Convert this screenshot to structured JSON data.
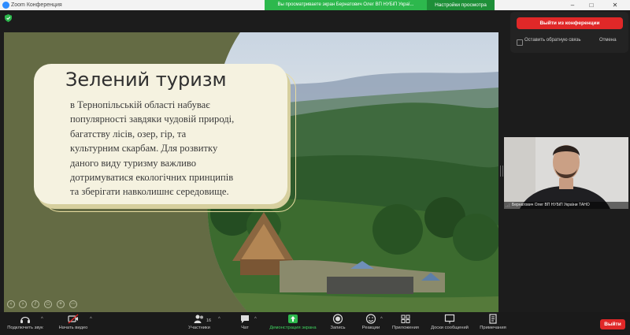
{
  "window": {
    "app_title": "Zoom Конференция",
    "share_banner": "Вы просматриваете экран Бернатович Олег ВП НУБіП Украї...",
    "view_options_label": "Настройки просмотра",
    "controls": {
      "minimize": "–",
      "maximize": "□",
      "close": "✕"
    }
  },
  "slide": {
    "title": "Зелений туризм",
    "body": "в Тернопільській області набуває\nпопулярності завдяки чудовій природі,\nбагатству лісів, озер, гір, та\nкультурним скарбам. Для розвитку\nданого виду туризму   важливо\nдотримуватися екологічних принципів\nта зберігати навколишнє середовище.",
    "background_color": "#646b44",
    "controls": [
      "prev-icon",
      "next-icon",
      "pen-icon",
      "copy-icon",
      "zoom-icon",
      "more-icon"
    ]
  },
  "leave_panel": {
    "leave_button": "Выйти из конференции",
    "feedback_label": "Оставить обратную связь",
    "cancel_label": "Отмена"
  },
  "video": {
    "participant_name": "Бернатович Олег ВП НУБіП України ТАНО"
  },
  "toolbar": {
    "audio": "Подключить звук",
    "video": "Начать видео",
    "participants": "Участники",
    "participants_count": "16",
    "chat": "Чат",
    "share": "Демонстрация экрана",
    "record": "Запись",
    "reactions": "Реакции",
    "apps": "Приложения",
    "whiteboards": "Доски сообщений",
    "notes": "Примечания",
    "end": "Выйти"
  },
  "colors": {
    "accent_green": "#2db84d",
    "end_red": "#e02828",
    "share_green": "#3fd45f"
  }
}
